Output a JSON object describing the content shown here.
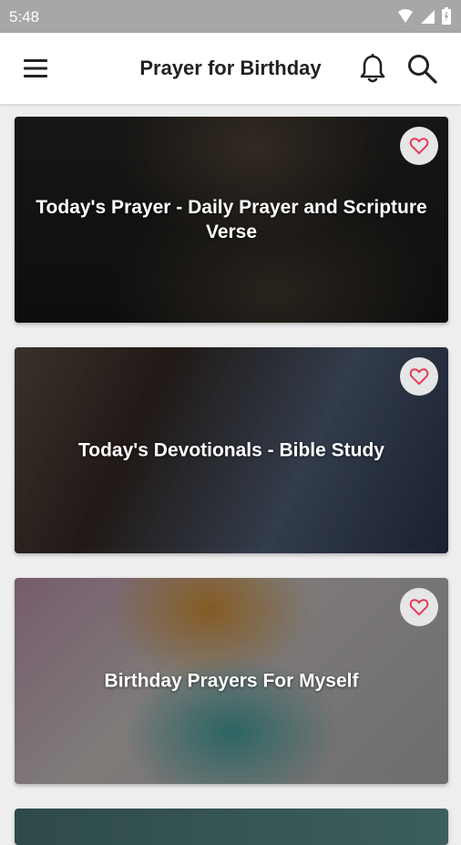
{
  "status_bar": {
    "time": "5:48"
  },
  "app_bar": {
    "title": "Prayer for Birthday"
  },
  "cards": [
    {
      "title": "Today's Prayer - Daily Prayer and Scripture Verse"
    },
    {
      "title": "Today's Devotionals - Bible Study"
    },
    {
      "title": "Birthday Prayers For Myself"
    }
  ],
  "colors": {
    "heart": "#e53957",
    "app_bar_bg": "#ffffff",
    "status_bar_bg": "#a7a7a7"
  }
}
